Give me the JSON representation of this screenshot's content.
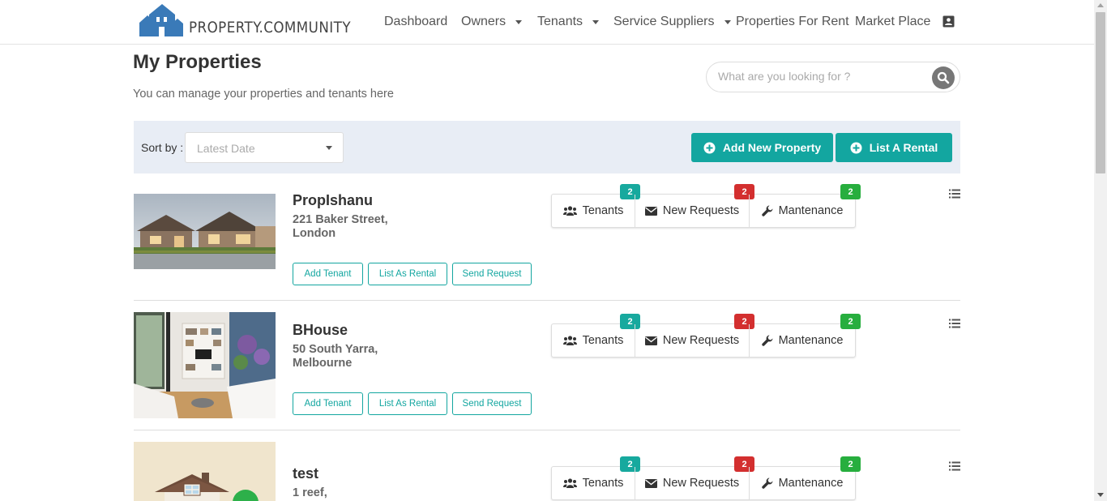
{
  "brand": {
    "name": "PROPERTY.COMMUNITY",
    "color": "#3a7ab8"
  },
  "nav": {
    "items": [
      {
        "label": "Dashboard",
        "has_dropdown": false
      },
      {
        "label": "Owners",
        "has_dropdown": true
      },
      {
        "label": "Tenants",
        "has_dropdown": true
      },
      {
        "label": "Service Suppliers",
        "has_dropdown": true
      },
      {
        "label": "Properties For Rent",
        "has_dropdown": false
      },
      {
        "label": "Market Place",
        "has_dropdown": false
      }
    ],
    "contact_icon": "contact-card-icon"
  },
  "page": {
    "title": "My Properties",
    "subtitle": "You can manage your properties and tenants here"
  },
  "search": {
    "placeholder": "What are you looking for ?",
    "icon": "search-icon"
  },
  "toolbar": {
    "sort_label": "Sort by :",
    "sort_value": "Latest Date",
    "add_property_label": "Add New Property",
    "list_rental_label": "List A Rental",
    "accent": "#13a6a0"
  },
  "stats_labels": {
    "tenants": "Tenants",
    "requests": "New Requests",
    "maintenance": "Mantenance"
  },
  "row_actions": {
    "add_tenant": "Add Tenant",
    "list_as_rental": "List As Rental",
    "send_request": "Send Request"
  },
  "badge_colors": {
    "tenants": "#17a99e",
    "requests": "#d32f2f",
    "maintenance": "#27ae3e"
  },
  "properties": [
    {
      "name": "PropIshanu",
      "address": "221 Baker Street, London",
      "tenants": "2",
      "requests": "2",
      "maintenance": "2",
      "image": "house-exterior"
    },
    {
      "name": "BHouse",
      "address": "50 South Yarra, Melbourne",
      "tenants": "2",
      "requests": "2",
      "maintenance": "2",
      "image": "living-room"
    },
    {
      "name": "test",
      "address": "1 reef,",
      "tenants": "2",
      "requests": "2",
      "maintenance": "2",
      "image": "house-illustration"
    }
  ]
}
